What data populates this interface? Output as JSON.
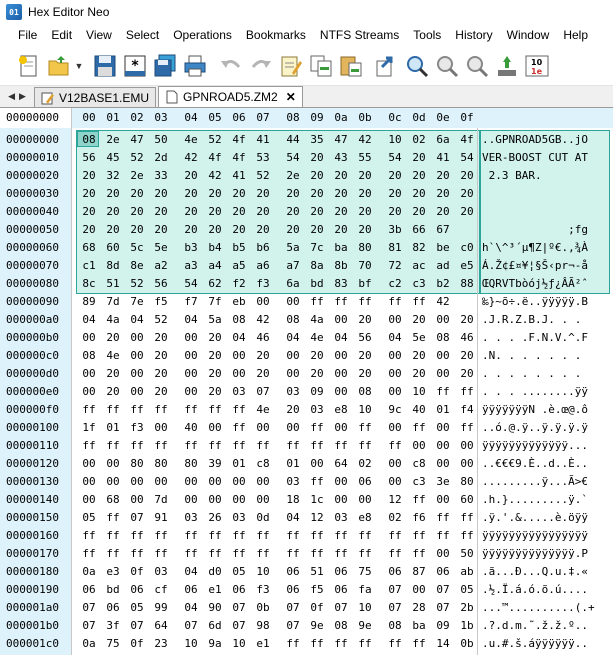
{
  "window": {
    "title": "Hex Editor Neo",
    "app_icon": "hex-editor-app-icon"
  },
  "menu": [
    "File",
    "Edit",
    "View",
    "Select",
    "Operations",
    "Bookmarks",
    "NTFS Streams",
    "Tools",
    "History",
    "Window",
    "Help"
  ],
  "toolbar": [
    {
      "name": "new-file-button",
      "icon": "new-file-icon"
    },
    {
      "name": "open-file-button",
      "icon": "open-folder-icon"
    },
    {
      "name": "open-dropdown-button",
      "icon": "chevron-down-icon"
    },
    {
      "name": "save-button",
      "icon": "floppy-disk-icon"
    },
    {
      "name": "save-as-button",
      "icon": "save-as-icon"
    },
    {
      "name": "save-all-button",
      "icon": "save-all-icon"
    },
    {
      "name": "print-button",
      "icon": "printer-icon"
    },
    {
      "name": "undo-button",
      "icon": "undo-icon"
    },
    {
      "name": "redo-button",
      "icon": "redo-icon"
    },
    {
      "name": "edit-button",
      "icon": "edit-note-icon"
    },
    {
      "name": "copy-button",
      "icon": "copy-icon"
    },
    {
      "name": "paste-button",
      "icon": "paste-icon"
    },
    {
      "name": "goto-button",
      "icon": "goto-arrow-icon"
    },
    {
      "name": "find-button",
      "icon": "find-icon"
    },
    {
      "name": "find-next-button",
      "icon": "find-next-icon"
    },
    {
      "name": "find-previous-button",
      "icon": "find-previous-icon"
    },
    {
      "name": "bookmark-button",
      "icon": "bookmark-icon"
    },
    {
      "name": "encoding-button",
      "icon": "encoding-icon"
    }
  ],
  "tabs": [
    {
      "label": "V12BASE1.EMU",
      "active": false
    },
    {
      "label": "GPNROAD5.ZM2",
      "active": true,
      "close": "✕"
    }
  ],
  "header": {
    "offset_label": "00000000",
    "columns": [
      "00",
      "01",
      "02",
      "03",
      "04",
      "05",
      "06",
      "07",
      "08",
      "09",
      "0a",
      "0b",
      "0c",
      "0d",
      "0e",
      "0f"
    ]
  },
  "rows": [
    {
      "offset": "00000000",
      "hex": [
        "08",
        "2e",
        "47",
        "50",
        "4e",
        "52",
        "4f",
        "41",
        "44",
        "35",
        "47",
        "42",
        "10",
        "02",
        "6a",
        "4f"
      ],
      "text": "..GPNROAD5GB..jO"
    },
    {
      "offset": "00000010",
      "hex": [
        "56",
        "45",
        "52",
        "2d",
        "42",
        "4f",
        "4f",
        "53",
        "54",
        "20",
        "43",
        "55",
        "54",
        "20",
        "41",
        "54"
      ],
      "text": "VER-BOOST CUT AT"
    },
    {
      "offset": "00000020",
      "hex": [
        "20",
        "32",
        "2e",
        "33",
        "20",
        "42",
        "41",
        "52",
        "2e",
        "20",
        "20",
        "20",
        "20",
        "20",
        "20",
        "20"
      ],
      "text": " 2.3 BAR.       "
    },
    {
      "offset": "00000030",
      "hex": [
        "20",
        "20",
        "20",
        "20",
        "20",
        "20",
        "20",
        "20",
        "20",
        "20",
        "20",
        "20",
        "20",
        "20",
        "20",
        "20"
      ],
      "text": "                "
    },
    {
      "offset": "00000040",
      "hex": [
        "20",
        "20",
        "20",
        "20",
        "20",
        "20",
        "20",
        "20",
        "20",
        "20",
        "20",
        "20",
        "20",
        "20",
        "20",
        "20"
      ],
      "text": "                "
    },
    {
      "offset": "00000050",
      "hex": [
        "20",
        "20",
        "20",
        "20",
        "20",
        "20",
        "20",
        "20",
        "20",
        "20",
        "20",
        "20",
        "3b",
        "66",
        "67"
      ],
      "text": "             ;fg"
    },
    {
      "offset": "00000060",
      "hex": [
        "68",
        "60",
        "5c",
        "5e",
        "b3",
        "b4",
        "b5",
        "b6",
        "5a",
        "7c",
        "ba",
        "80",
        "81",
        "82",
        "be",
        "c0"
      ],
      "text": "h`\\^³´µ¶Z|º€.‚¾À"
    },
    {
      "offset": "00000070",
      "hex": [
        "c1",
        "8d",
        "8e",
        "a2",
        "a3",
        "a4",
        "a5",
        "a6",
        "a7",
        "8a",
        "8b",
        "70",
        "72",
        "ac",
        "ad",
        "e5"
      ],
      "text": "Á.Ž¢£¤¥¦§Š‹pr¬-å"
    },
    {
      "offset": "00000080",
      "hex": [
        "8c",
        "51",
        "52",
        "56",
        "54",
        "62",
        "f2",
        "f3",
        "6a",
        "bd",
        "83",
        "bf",
        "c2",
        "c3",
        "b2",
        "88"
      ],
      "text": "ŒQRVTbòój½ƒ¿ÂÃ²ˆ"
    },
    {
      "offset": "00000090",
      "hex": [
        "89",
        "7d",
        "7e",
        "f5",
        "f7",
        "7f",
        "eb",
        "00",
        "00",
        "ff",
        "ff",
        "ff",
        "ff",
        "ff",
        "42"
      ],
      "text": "‰}~õ÷.ë..ÿÿÿÿÿ.B"
    },
    {
      "offset": "000000a0",
      "hex": [
        "04",
        "4a",
        "04",
        "52",
        "04",
        "5a",
        "08",
        "42",
        "08",
        "4a",
        "00",
        "20",
        "00",
        "20",
        "00",
        "20"
      ],
      "text": ".J.R.Z.B.J. . . "
    },
    {
      "offset": "000000b0",
      "hex": [
        "00",
        "20",
        "00",
        "20",
        "00",
        "20",
        "04",
        "46",
        "04",
        "4e",
        "04",
        "56",
        "04",
        "5e",
        "08",
        "46"
      ],
      "text": ". . . .F.N.V.^.F"
    },
    {
      "offset": "000000c0",
      "hex": [
        "08",
        "4e",
        "00",
        "20",
        "00",
        "20",
        "00",
        "20",
        "00",
        "20",
        "00",
        "20",
        "00",
        "20",
        "00",
        "20"
      ],
      "text": ".N. . . . . . . "
    },
    {
      "offset": "000000d0",
      "hex": [
        "00",
        "20",
        "00",
        "20",
        "00",
        "20",
        "00",
        "20",
        "00",
        "20",
        "00",
        "20",
        "00",
        "20",
        "00",
        "20"
      ],
      "text": ". . . . . . . . "
    },
    {
      "offset": "000000e0",
      "hex": [
        "00",
        "20",
        "00",
        "20",
        "00",
        "20",
        "03",
        "07",
        "03",
        "09",
        "00",
        "08",
        "00",
        "10",
        "ff",
        "ff"
      ],
      "text": ". . . ........ÿÿ"
    },
    {
      "offset": "000000f0",
      "hex": [
        "ff",
        "ff",
        "ff",
        "ff",
        "ff",
        "ff",
        "ff",
        "4e",
        "20",
        "03",
        "e8",
        "10",
        "9c",
        "40",
        "01",
        "f4"
      ],
      "text": "ÿÿÿÿÿÿÿN .è.œ@.ô"
    },
    {
      "offset": "00000100",
      "hex": [
        "1f",
        "01",
        "f3",
        "00",
        "40",
        "00",
        "ff",
        "00",
        "00",
        "ff",
        "00",
        "ff",
        "00",
        "ff",
        "00",
        "ff"
      ],
      "text": "..ó.@.ÿ..ÿ.ÿ.ÿ.ÿ"
    },
    {
      "offset": "00000110",
      "hex": [
        "ff",
        "ff",
        "ff",
        "ff",
        "ff",
        "ff",
        "ff",
        "ff",
        "ff",
        "ff",
        "ff",
        "ff",
        "ff",
        "00",
        "00",
        "00"
      ],
      "text": "ÿÿÿÿÿÿÿÿÿÿÿÿÿ..."
    },
    {
      "offset": "00000120",
      "hex": [
        "00",
        "00",
        "80",
        "80",
        "80",
        "39",
        "01",
        "c8",
        "01",
        "00",
        "64",
        "02",
        "00",
        "c8",
        "00",
        "00"
      ],
      "text": "..€€€9.È..d..È.."
    },
    {
      "offset": "00000130",
      "hex": [
        "00",
        "00",
        "00",
        "00",
        "00",
        "00",
        "00",
        "00",
        "03",
        "ff",
        "00",
        "06",
        "00",
        "c3",
        "3e",
        "80"
      ],
      "text": ".........ÿ...Ã>€"
    },
    {
      "offset": "00000140",
      "hex": [
        "00",
        "68",
        "00",
        "7d",
        "00",
        "00",
        "00",
        "00",
        "18",
        "1c",
        "00",
        "00",
        "12",
        "ff",
        "00",
        "60"
      ],
      "text": ".h.}.........ÿ.`"
    },
    {
      "offset": "00000150",
      "hex": [
        "05",
        "ff",
        "07",
        "91",
        "03",
        "26",
        "03",
        "0d",
        "04",
        "12",
        "03",
        "e8",
        "02",
        "f6",
        "ff",
        "ff"
      ],
      "text": ".ÿ.'.&.....è.öÿÿ"
    },
    {
      "offset": "00000160",
      "hex": [
        "ff",
        "ff",
        "ff",
        "ff",
        "ff",
        "ff",
        "ff",
        "ff",
        "ff",
        "ff",
        "ff",
        "ff",
        "ff",
        "ff",
        "ff",
        "ff"
      ],
      "text": "ÿÿÿÿÿÿÿÿÿÿÿÿÿÿÿÿ"
    },
    {
      "offset": "00000170",
      "hex": [
        "ff",
        "ff",
        "ff",
        "ff",
        "ff",
        "ff",
        "ff",
        "ff",
        "ff",
        "ff",
        "ff",
        "ff",
        "ff",
        "ff",
        "00",
        "50"
      ],
      "text": "ÿÿÿÿÿÿÿÿÿÿÿÿÿÿ.P"
    },
    {
      "offset": "00000180",
      "hex": [
        "0a",
        "e3",
        "0f",
        "03",
        "04",
        "d0",
        "05",
        "10",
        "06",
        "51",
        "06",
        "75",
        "06",
        "87",
        "06",
        "ab"
      ],
      "text": ".ã...Ð...Q.u.‡.«"
    },
    {
      "offset": "00000190",
      "hex": [
        "06",
        "bd",
        "06",
        "cf",
        "06",
        "e1",
        "06",
        "f3",
        "06",
        "f5",
        "06",
        "fa",
        "07",
        "00",
        "07",
        "05"
      ],
      "text": ".½.Ï.á.ó.õ.ú...."
    },
    {
      "offset": "000001a0",
      "hex": [
        "07",
        "06",
        "05",
        "99",
        "04",
        "90",
        "07",
        "0b",
        "07",
        "0f",
        "07",
        "10",
        "07",
        "28",
        "07",
        "2b"
      ],
      "text": "...™..........(.+"
    },
    {
      "offset": "000001b0",
      "hex": [
        "07",
        "3f",
        "07",
        "64",
        "07",
        "6d",
        "07",
        "98",
        "07",
        "9e",
        "08",
        "9e",
        "08",
        "ba",
        "09",
        "1b"
      ],
      "text": ".?.d.m.˜.ž.ž.º.."
    },
    {
      "offset": "000001c0",
      "hex": [
        "0a",
        "75",
        "0f",
        "23",
        "10",
        "9a",
        "10",
        "e1",
        "ff",
        "ff",
        "ff",
        "ff",
        "ff",
        "ff",
        "14",
        "0b"
      ],
      "text": ".u.#.š.áÿÿÿÿÿÿ.."
    }
  ]
}
